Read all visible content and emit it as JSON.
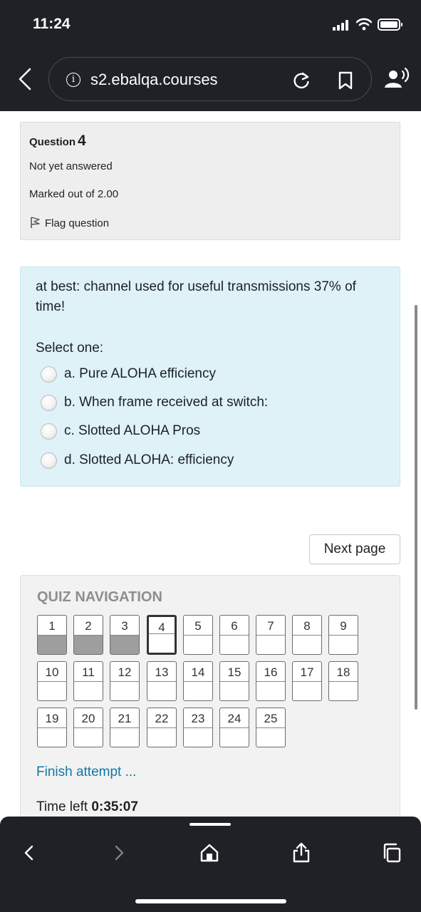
{
  "status_bar": {
    "time": "11:24"
  },
  "browser": {
    "url": "s2.ebalqa.courses"
  },
  "question_info": {
    "label": "Question",
    "number": "4",
    "state": "Not yet answered",
    "marks": "Marked out of 2.00",
    "flag_label": "Flag question"
  },
  "question": {
    "text": "at best: channel used for useful transmissions 37% of time!",
    "prompt": "Select one:",
    "answers": [
      {
        "label": "a. Pure ALOHA efficiency"
      },
      {
        "label": "b. When frame received at switch:"
      },
      {
        "label": "c. Slotted ALOHA Pros"
      },
      {
        "label": "d. Slotted ALOHA: efficiency"
      }
    ]
  },
  "next_button": "Next page",
  "quiz_navigation": {
    "title": "QUIZ NAVIGATION",
    "buttons": [
      {
        "label": "1",
        "answered": true
      },
      {
        "label": "2",
        "answered": true
      },
      {
        "label": "3",
        "answered": true
      },
      {
        "label": "4",
        "current": true
      },
      {
        "label": "5"
      },
      {
        "label": "6"
      },
      {
        "label": "7"
      },
      {
        "label": "8"
      },
      {
        "label": "9"
      },
      {
        "label": "10"
      },
      {
        "label": "11"
      },
      {
        "label": "12"
      },
      {
        "label": "13"
      },
      {
        "label": "14"
      },
      {
        "label": "15"
      },
      {
        "label": "16"
      },
      {
        "label": "17"
      },
      {
        "label": "18"
      },
      {
        "label": "19"
      },
      {
        "label": "20"
      },
      {
        "label": "21"
      },
      {
        "label": "22"
      },
      {
        "label": "23"
      },
      {
        "label": "24"
      },
      {
        "label": "25"
      }
    ],
    "finish_link": "Finish attempt ...",
    "time_left_label": "Time left",
    "time_left_value": "0:35:07"
  },
  "icons": {
    "back": "chevron-left-icon",
    "info": "info-icon",
    "reload": "reload-icon",
    "bookmark": "bookmark-icon",
    "voice": "person-speaking-icon",
    "flag": "flag-icon",
    "share": "share-icon",
    "tabs": "tabs-icon",
    "home": "home-icon"
  },
  "colors": {
    "chrome_bg": "#1f2126",
    "question_bg": "#def2f8",
    "link": "#1177a7",
    "answered_fill": "#9e9e9e"
  }
}
